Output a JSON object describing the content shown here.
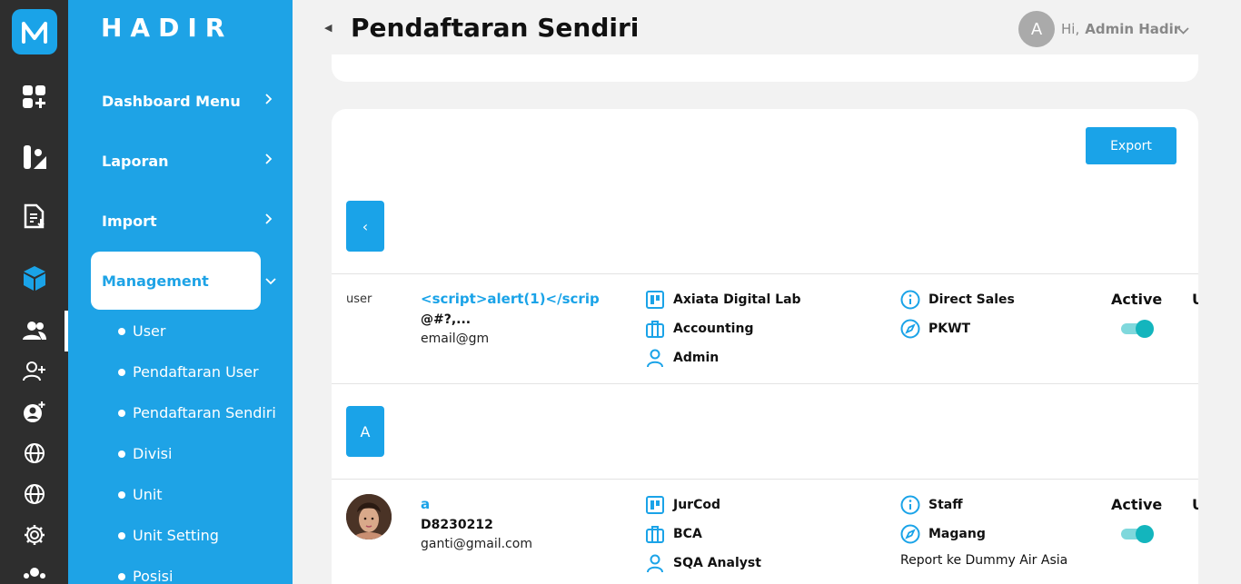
{
  "app": {
    "brand": "HADIR"
  },
  "header": {
    "title": "Pendaftaran Sendiri",
    "avatar_initial": "A",
    "greeting": "Hi,",
    "user_name": "Admin Hadir"
  },
  "sidebar": {
    "nav": [
      {
        "label": "Dashboard Menu"
      },
      {
        "label": "Laporan"
      },
      {
        "label": "Import"
      }
    ],
    "active": "Management",
    "sub_items": [
      {
        "label": "User"
      },
      {
        "label": "Pendaftaran User"
      },
      {
        "label": "Pendaftaran Sendiri"
      },
      {
        "label": "Divisi"
      },
      {
        "label": "Unit"
      },
      {
        "label": "Unit Setting"
      },
      {
        "label": "Posisi"
      }
    ]
  },
  "rail_icons": [
    "app-logo-icon",
    "dashboard-add-icon",
    "report-icon",
    "document-import-icon",
    "box-icon",
    "users-icon",
    "user-add-icon",
    "user-settings-icon",
    "globe-icon",
    "globe-icon",
    "gear-icon",
    "group-icon"
  ],
  "content": {
    "export_label": "Export",
    "groups": [
      {
        "button_label": "‹",
        "row": {
          "role": "user",
          "name": "<script>alert(1)</scrip",
          "code": "@#?,...",
          "email": "email@gm",
          "company": "Axiata Digital Lab",
          "division": "Accounting",
          "position": "Admin",
          "department": "Direct Sales",
          "contract": "PKWT",
          "note": "",
          "status": "Active",
          "active": true,
          "cut_text": "U"
        }
      },
      {
        "button_label": "A",
        "row": {
          "role": "",
          "name": "a",
          "code": "D8230212",
          "email": "ganti@gmail.com",
          "company": "JurCod",
          "division": "BCA",
          "position": "SQA Analyst",
          "department": "Staff",
          "contract": "Magang",
          "note": "Report ke Dummy Air Asia",
          "status": "Active",
          "active": true,
          "cut_text": "U"
        }
      }
    ]
  },
  "colors": {
    "accent": "#1ea3e6",
    "rail": "#2e2e2e",
    "toggle": "#13b5bd"
  }
}
